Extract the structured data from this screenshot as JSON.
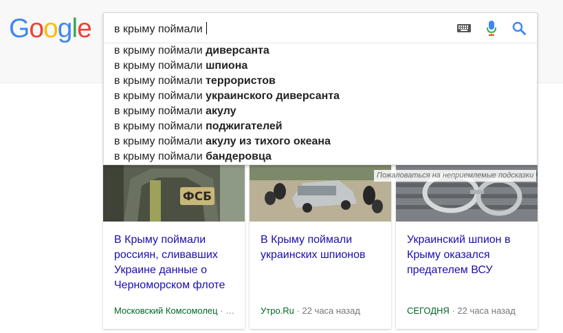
{
  "logo": {
    "text": "Google",
    "letters": [
      "G",
      "o",
      "o",
      "g",
      "l",
      "e"
    ],
    "colors": [
      "#4285f4",
      "#ea4335",
      "#fbbc05",
      "#4285f4",
      "#34a853",
      "#ea4335"
    ]
  },
  "search": {
    "query": "в крыму поймали",
    "suggestions": [
      {
        "prefix": "в крыму поймали ",
        "completion": "диверсанта"
      },
      {
        "prefix": "в крыму поймали ",
        "completion": "шпиона"
      },
      {
        "prefix": "в крыму поймали ",
        "completion": "террористов"
      },
      {
        "prefix": "в крыму поймали ",
        "completion": "украинского диверсанта"
      },
      {
        "prefix": "в крыму поймали ",
        "completion": "акулу"
      },
      {
        "prefix": "в крыму поймали ",
        "completion": "поджигателей"
      },
      {
        "prefix": "в крыму поймали ",
        "completion": "акулу из тихого океана"
      },
      {
        "prefix": "в крыму поймали ",
        "completion": "бандеровца"
      }
    ],
    "report_link": "Пожаловаться на неприемлемые подсказки",
    "icons": [
      "keyboard-icon",
      "microphone-icon",
      "search-icon"
    ]
  },
  "news": [
    {
      "title": "В Крыму поймали россиян, сливавших Украине данные о Черноморском флоте",
      "source": "Московский Комсомолец",
      "separator": " · ",
      "time": "…",
      "image_text": "ФСБ"
    },
    {
      "title": "В Крыму поймали украинских шпионов",
      "source": "Утро.Ru",
      "separator": " · ",
      "time": "22 часа назад"
    },
    {
      "title": "Украинский шпион в Крыму оказался предателем ВСУ",
      "source": "СЕГОДНЯ",
      "separator": " · ",
      "time": "22 часа назад"
    }
  ]
}
